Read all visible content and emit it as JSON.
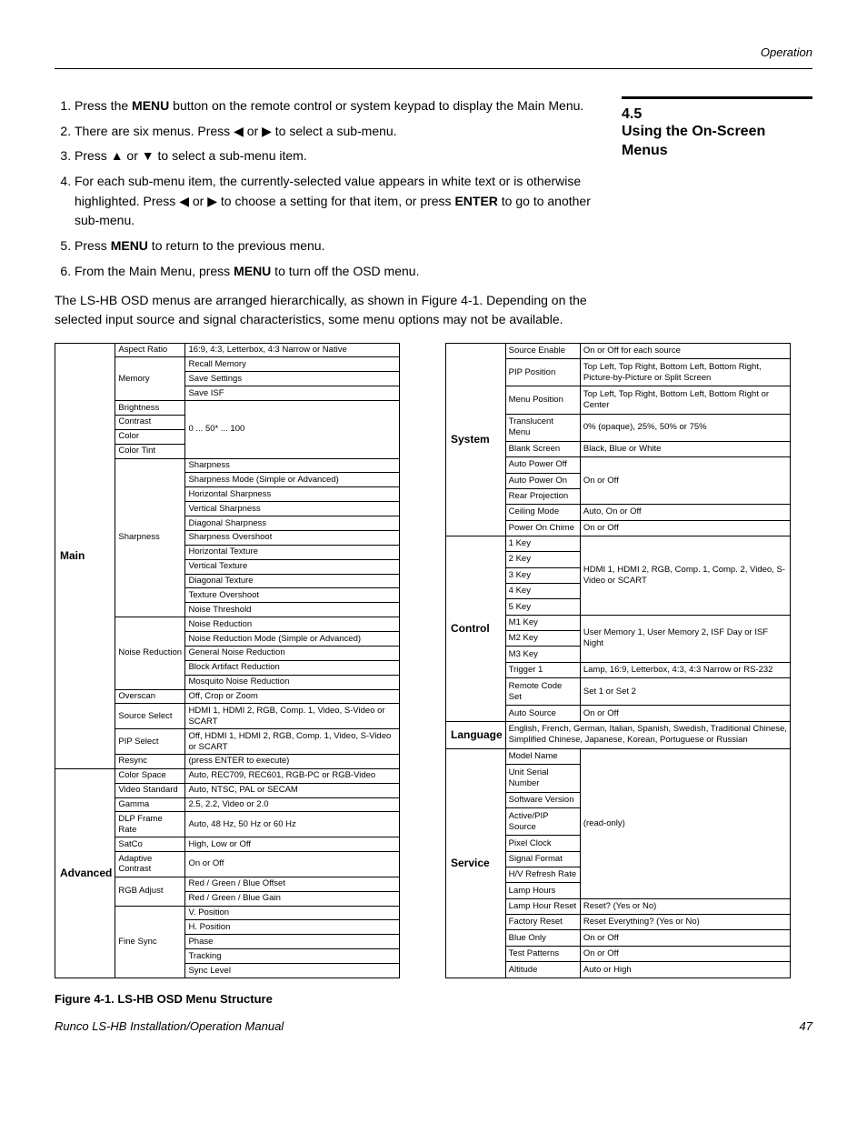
{
  "header_corner": "Operation",
  "section_number": "4.5",
  "section_title": "Using the On-Screen Menus",
  "steps_intro": {
    "s1a": "Press the ",
    "s1b": "MENU",
    "s1c": " button on the remote control or system keypad to display the Main Menu.",
    "s2a": "There are six menus. Press ",
    "s2b": " or ",
    "s2c": " to select a sub-menu.",
    "s3a": "Press ",
    "s3b": " or ",
    "s3c": " to select a sub-menu item.",
    "s4a": "For each sub-menu item, the currently-selected value appears in white text or is otherwise highlighted. Press ",
    "s4b": " or ",
    "s4c": " to choose a setting for that item, or press ",
    "s4d": "ENTER",
    "s4e": " to go to another sub-menu.",
    "s5a": "Press ",
    "s5b": "MENU",
    "s5c": " to return to the previous menu.",
    "s6a": "From the Main Menu, press ",
    "s6b": "MENU",
    "s6c": " to turn off the OSD menu."
  },
  "paragraph": "The LS-HB OSD menus are arranged hierarchically, as shown in Figure 4-1. Depending on the selected input source and signal characteristics, some menu options may not be available.",
  "left_table": {
    "cats": [
      "Main",
      "Advanced"
    ],
    "main_rows": [
      [
        "Aspect Ratio",
        "16:9, 4:3, Letterbox, 4:3 Narrow or Native"
      ],
      [
        "Memory",
        "Recall Memory"
      ],
      [
        "",
        "Save Settings"
      ],
      [
        "",
        "Save ISF"
      ],
      [
        "Brightness",
        ""
      ],
      [
        "Contrast",
        "0 ... 50* ... 100"
      ],
      [
        "Color",
        ""
      ],
      [
        "Color Tint",
        ""
      ],
      [
        "Sharpness",
        "Sharpness"
      ],
      [
        "",
        "Sharpness Mode (Simple or Advanced)"
      ],
      [
        "",
        "Horizontal Sharpness"
      ],
      [
        "",
        "Vertical Sharpness"
      ],
      [
        "",
        "Diagonal Sharpness"
      ],
      [
        "",
        "Sharpness Overshoot"
      ],
      [
        "",
        "Horizontal Texture"
      ],
      [
        "",
        "Vertical Texture"
      ],
      [
        "",
        "Diagonal Texture"
      ],
      [
        "",
        "Texture Overshoot"
      ],
      [
        "",
        "Noise Threshold"
      ],
      [
        "Noise Reduction",
        "Noise Reduction"
      ],
      [
        "",
        "Noise Reduction Mode (Simple or Advanced)"
      ],
      [
        "",
        "General Noise Reduction"
      ],
      [
        "",
        "Block Artifact Reduction"
      ],
      [
        "",
        "Mosquito Noise Reduction"
      ],
      [
        "Overscan",
        "Off, Crop or Zoom"
      ],
      [
        "Source Select",
        "HDMI 1, HDMI 2, RGB, Comp. 1, Video, S-Video or SCART"
      ],
      [
        "PIP Select",
        "Off, HDMI 1, HDMI 2, RGB, Comp. 1, Video, S-Video or SCART"
      ],
      [
        "Resync",
        "(press ENTER to execute)"
      ]
    ],
    "adv_rows": [
      [
        "Color Space",
        "Auto, REC709, REC601, RGB-PC or RGB-Video"
      ],
      [
        "Video Standard",
        "Auto, NTSC, PAL or SECAM"
      ],
      [
        "Gamma",
        "2.5, 2.2, Video or 2.0"
      ],
      [
        "DLP Frame Rate",
        "Auto, 48 Hz, 50 Hz or 60 Hz"
      ],
      [
        "SatCo",
        "High, Low or Off"
      ],
      [
        "Adaptive Contrast",
        "On or Off"
      ],
      [
        "RGB Adjust",
        "Red / Green / Blue Offset"
      ],
      [
        "",
        "Red / Green / Blue Gain"
      ],
      [
        "Fine Sync",
        "V. Position"
      ],
      [
        "",
        "H. Position"
      ],
      [
        "",
        "Phase"
      ],
      [
        "",
        "Tracking"
      ],
      [
        "",
        "Sync Level"
      ]
    ]
  },
  "right_table": {
    "cats": [
      "System",
      "Control",
      "Language",
      "Service"
    ],
    "system_rows": [
      [
        "Source Enable",
        "On or Off for each source"
      ],
      [
        "PIP Position",
        "Top Left, Top Right, Bottom Left, Bottom Right, Picture-by-Picture or Split Screen"
      ],
      [
        "Menu Position",
        "Top Left, Top Right, Bottom Left, Bottom Right or Center"
      ],
      [
        "Translucent Menu",
        "0% (opaque), 25%, 50% or 75%"
      ],
      [
        "Blank Screen",
        "Black, Blue or White"
      ],
      [
        "Auto Power Off",
        ""
      ],
      [
        "Auto Power On",
        "On or Off"
      ],
      [
        "Rear Projection",
        ""
      ],
      [
        "Ceiling Mode",
        "Auto, On or Off"
      ],
      [
        "Power On Chime",
        "On or Off"
      ]
    ],
    "control_rows": [
      [
        "1 Key",
        ""
      ],
      [
        "2 Key",
        "HDMI 1, HDMI 2, RGB, Comp. 1,"
      ],
      [
        "3 Key",
        "Comp. 2, Video, S-Video or"
      ],
      [
        "4 Key",
        "SCART"
      ],
      [
        "5 Key",
        ""
      ],
      [
        "M1 Key",
        "User Memory 1, User Memory 2,"
      ],
      [
        "M2 Key",
        "ISF Day or ISF Night"
      ],
      [
        "M3 Key",
        ""
      ],
      [
        "Trigger 1",
        "Lamp, 16:9, Letterbox, 4:3, 4:3 Narrow or RS-232"
      ],
      [
        "Remote Code Set",
        "Set 1 or Set 2"
      ],
      [
        "Auto Source",
        "On or Off"
      ]
    ],
    "language_value": "English, French, German, Italian, Spanish, Swedish, Traditional Chinese, Simplified Chinese, Japanese, Korean, Portuguese or Russian",
    "service_rows": [
      [
        "Model Name",
        ""
      ],
      [
        "Unit Serial Number",
        ""
      ],
      [
        "Software Version",
        ""
      ],
      [
        "Active/PIP Source",
        "(read-only)"
      ],
      [
        "Pixel Clock",
        ""
      ],
      [
        "Signal Format",
        ""
      ],
      [
        "H/V Refresh Rate",
        ""
      ],
      [
        "Lamp Hours",
        ""
      ],
      [
        "Lamp Hour Reset",
        "Reset? (Yes or No)"
      ],
      [
        "Factory Reset",
        "Reset Everything? (Yes or No)"
      ],
      [
        "Blue Only",
        "On or Off"
      ],
      [
        "Test Patterns",
        "On or Off"
      ],
      [
        "Altitude",
        "Auto or High"
      ]
    ]
  },
  "figure_caption": "Figure 4-1. LS-HB OSD Menu Structure",
  "footer_left": "Runco LS-HB Installation/Operation Manual",
  "footer_right": "47"
}
